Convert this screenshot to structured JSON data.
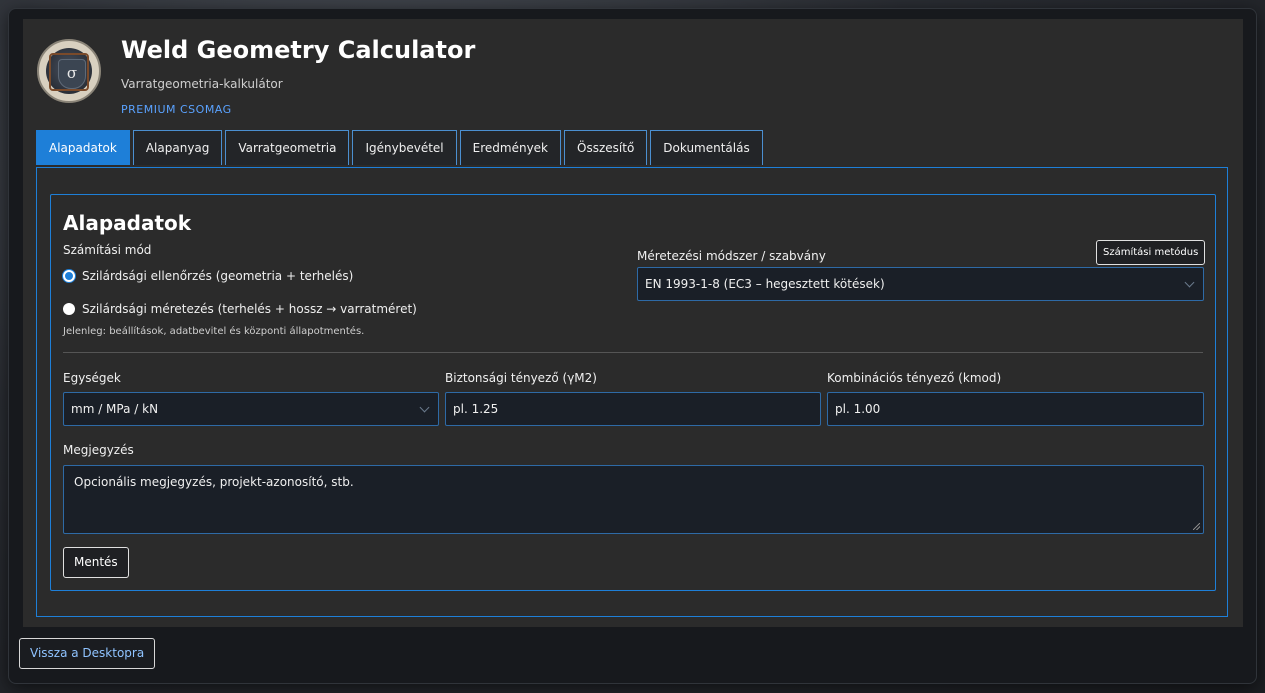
{
  "header": {
    "title": "Weld Geometry Calculator",
    "subtitle": "Varratgeometria-kalkulátor",
    "package": "PREMIUM CSOMAG",
    "logo_glyph": "σ"
  },
  "tabs": [
    {
      "label": "Alapadatok",
      "active": true
    },
    {
      "label": "Alapanyag"
    },
    {
      "label": "Varratgeometria"
    },
    {
      "label": "Igénybevétel"
    },
    {
      "label": "Eredmények"
    },
    {
      "label": "Összesítő"
    },
    {
      "label": "Dokumentálás"
    }
  ],
  "section": {
    "title": "Alapadatok",
    "calc_mode": {
      "label": "Számítási mód",
      "options": [
        {
          "label": "Szilárdsági ellenőrzés (geometria + terhelés)",
          "selected": true
        },
        {
          "label": "Szilárdsági méretezés (terhelés + hossz → varratméret)",
          "selected": false
        }
      ],
      "hint": "Jelenleg: beállítások, adatbevitel és központi állapotmentés."
    },
    "standard": {
      "label": "Méretezési módszer / szabvány",
      "value": "EN 1993-1-8 (EC3 – hegesztett kötések)",
      "method_button": "Számítási metódus"
    },
    "units": {
      "label": "Egységek",
      "value": "mm / MPa / kN"
    },
    "safety": {
      "label": "Biztonsági tényező (γM2)",
      "placeholder": "pl. 1.25"
    },
    "kmod": {
      "label": "Kombinációs tényező (kmod)",
      "placeholder": "pl. 1.00"
    },
    "note": {
      "label": "Megjegyzés",
      "placeholder": "Opcionális megjegyzés, projekt-azonosító, stb."
    },
    "save_label": "Mentés"
  },
  "footer": {
    "back_label": "Vissza a Desktopra"
  },
  "colors": {
    "accent": "#1e7fd8",
    "link": "#8fc3ff",
    "panel": "#2b2b2b"
  }
}
